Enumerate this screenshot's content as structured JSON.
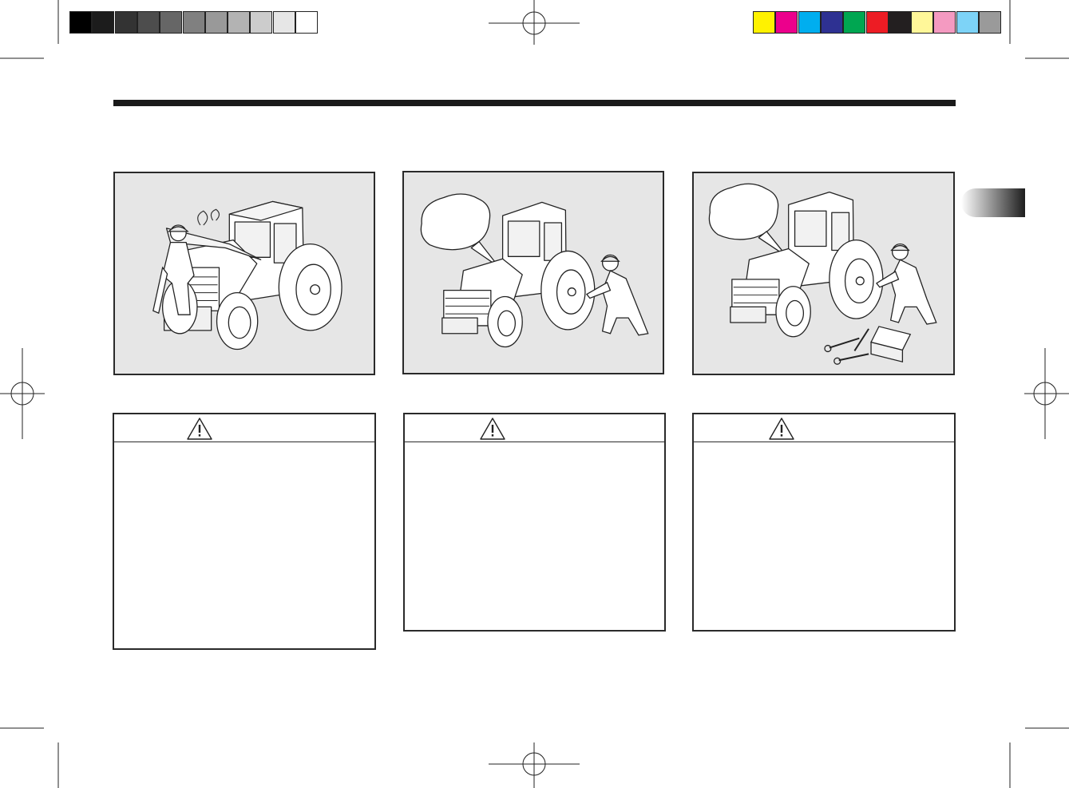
{
  "color_bar": {
    "grays": [
      "#000000",
      "#1c1c1c",
      "#333333",
      "#4d4d4d",
      "#666666",
      "#808080",
      "#999999",
      "#b3b3b3",
      "#cccccc",
      "#e6e6e6",
      "#ffffff"
    ],
    "process": [
      "#fff200",
      "#ec008c",
      "#00aeef",
      "#2e3192",
      "#00a651",
      "#ed1c24",
      "#231f20",
      "#fff799",
      "#f49ac1",
      "#7dd3f7",
      "#9a9a9a"
    ]
  },
  "illustrations": [
    {
      "icon": "tractor-hood-open-mechanic-icon"
    },
    {
      "icon": "tractor-mechanic-wheel-speech-icon"
    },
    {
      "icon": "tractor-mechanic-tools-speech-icon"
    }
  ],
  "warnings": [
    {
      "icon": "warning-triangle-icon"
    },
    {
      "icon": "warning-triangle-icon"
    },
    {
      "icon": "warning-triangle-icon"
    }
  ],
  "section_tab": {
    "icon": "section-tab-marker"
  }
}
